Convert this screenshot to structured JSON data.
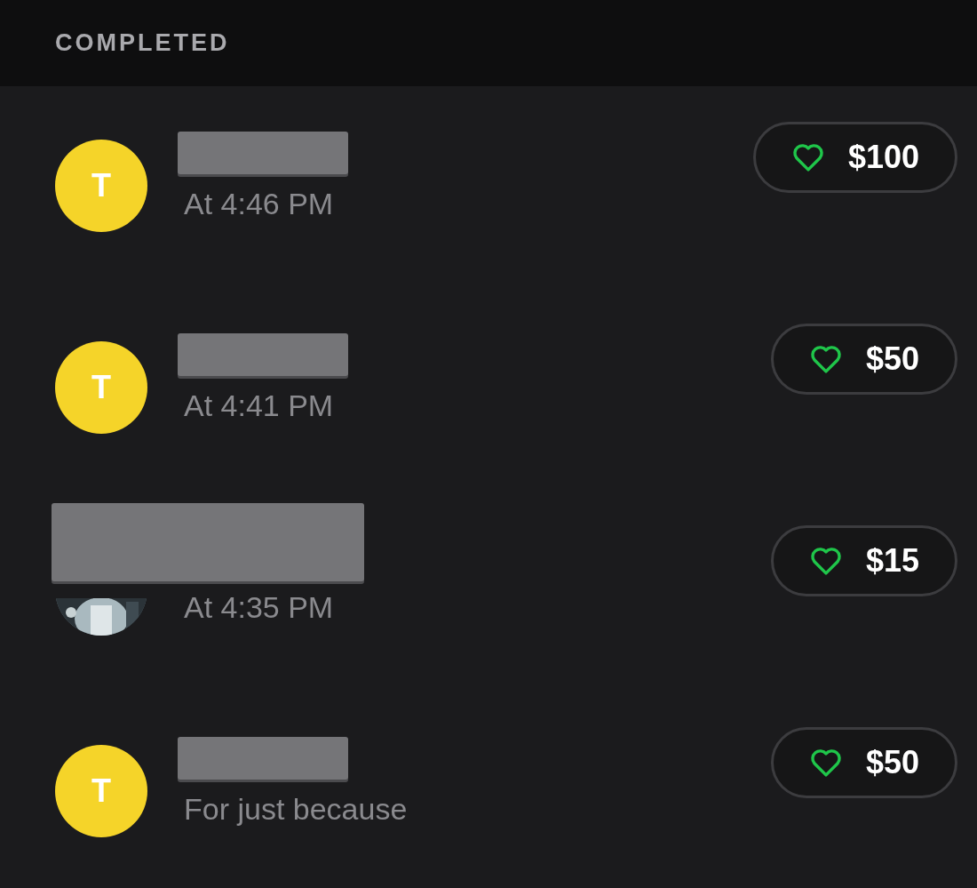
{
  "section_header": "COMPLETED",
  "rows": [
    {
      "avatar": {
        "kind": "letter",
        "letter": "T"
      },
      "subtitle": "At 4:46 PM",
      "amount": "$100"
    },
    {
      "avatar": {
        "kind": "letter",
        "letter": "T"
      },
      "subtitle": "At 4:41 PM",
      "amount": "$50"
    },
    {
      "subtitle": "At 4:35 PM",
      "amount": "$15"
    },
    {
      "avatar": {
        "kind": "letter",
        "letter": "T"
      },
      "subtitle": "For just because",
      "amount": "$50"
    }
  ]
}
